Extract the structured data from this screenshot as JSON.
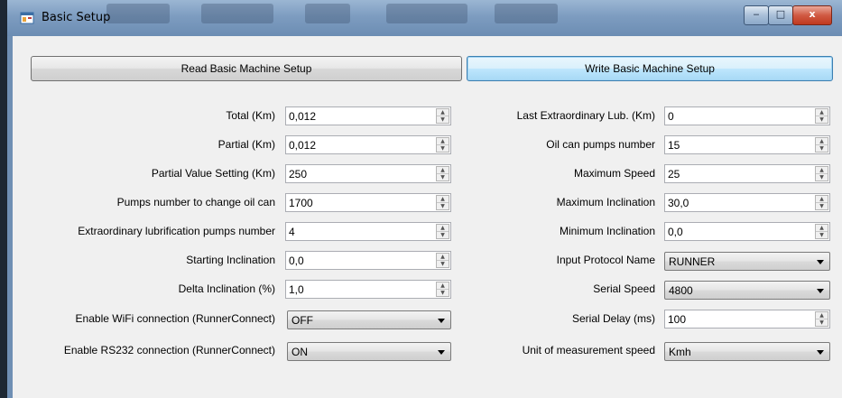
{
  "window": {
    "title": "Basic Setup",
    "controls": {
      "minimize": "‒",
      "maximize": "□",
      "close": "x"
    }
  },
  "buttons": {
    "read": "Read Basic Machine Setup",
    "write": "Write Basic Machine Setup"
  },
  "left": [
    {
      "label": "Total (Km)",
      "value": "0,012",
      "type": "numeric"
    },
    {
      "label": "Partial (Km)",
      "value": "0,012",
      "type": "numeric"
    },
    {
      "label": "Partial Value Setting (Km)",
      "value": "250",
      "type": "numeric"
    },
    {
      "label": "Pumps number to change oil can",
      "value": "1700",
      "type": "numeric"
    },
    {
      "label": "Extraordinary lubrification pumps number",
      "value": "4",
      "type": "numeric"
    },
    {
      "label": "Starting Inclination",
      "value": "0,0",
      "type": "numeric"
    },
    {
      "label": "Delta Inclination (%)",
      "value": "1,0",
      "type": "numeric"
    },
    {
      "label": "Enable WiFi connection (RunnerConnect)",
      "value": "OFF",
      "type": "combo"
    },
    {
      "label": "Enable RS232 connection (RunnerConnect)",
      "value": "ON",
      "type": "combo"
    }
  ],
  "right": [
    {
      "label": "Last Extraordinary Lub. (Km)",
      "value": "0",
      "type": "numeric"
    },
    {
      "label": "Oil can pumps number",
      "value": "15",
      "type": "numeric"
    },
    {
      "label": "Maximum Speed",
      "value": "25",
      "type": "numeric"
    },
    {
      "label": "Maximum Inclination",
      "value": "30,0",
      "type": "numeric"
    },
    {
      "label": "Minimum Inclination",
      "value": "0,0",
      "type": "numeric"
    },
    {
      "label": "Input Protocol Name",
      "value": "RUNNER",
      "type": "combo"
    },
    {
      "label": "Serial Speed",
      "value": "4800",
      "type": "combo"
    },
    {
      "label": "Serial Delay (ms)",
      "value": "100",
      "type": "numeric"
    },
    {
      "label": "Unit of measurement speed",
      "value": "Kmh",
      "type": "combo"
    }
  ],
  "icons": {
    "app": "app-window-icon",
    "spin_up": "▲",
    "spin_down": "▼"
  }
}
